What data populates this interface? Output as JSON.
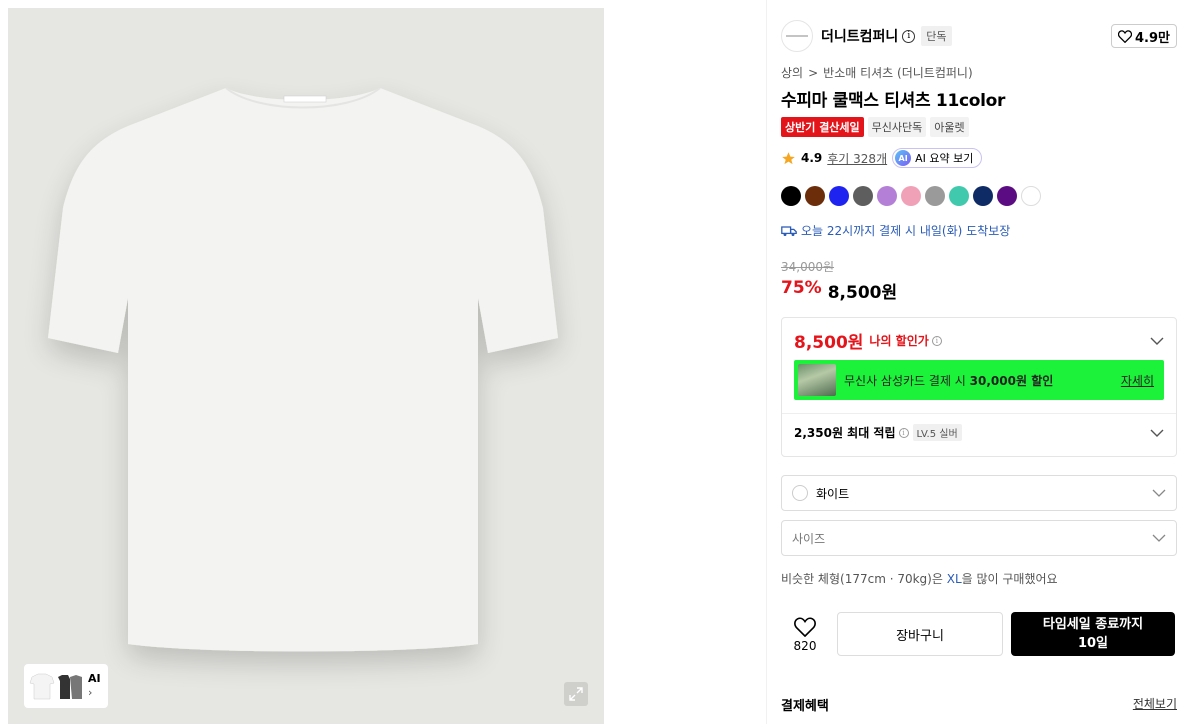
{
  "thumbnail": {
    "ai_label": "AI",
    "chevron": "›"
  },
  "brand": {
    "name": "더니트컴퍼니",
    "info": "i",
    "exclusive": "단독",
    "likes": "4.9만"
  },
  "breadcrumb": {
    "category": "상의",
    "separator": ">",
    "subcategory": "반소매 티셔츠 (더니트컴퍼니)"
  },
  "product": {
    "title": "수피마 쿨맥스 티셔츠 11color",
    "tags": [
      "상반기 결산세일",
      "무신사단독",
      "아울렛"
    ],
    "rating": "4.9",
    "review_count": "후기 328개",
    "ai_badge": "AI",
    "ai_summary": "AI 요약 보기"
  },
  "colors": [
    "#000000",
    "#6b2d0a",
    "#1f23f0",
    "#5e5e5e",
    "#b47fd6",
    "#f0a1b8",
    "#9a9a9a",
    "#40c9ad",
    "#0f2b66",
    "#5b0c82",
    "#ffffff"
  ],
  "delivery": {
    "text": "오늘 22시까지 결제 시 내일(화) 도착보장"
  },
  "price": {
    "original": "34,000원",
    "discount": "75%",
    "final": "8,500원"
  },
  "benefits": {
    "my_price": "8,500원",
    "my_price_label": "나의 할인가",
    "card_text_prefix": "무신사 삼성카드 결제 시 ",
    "card_text_bold": "30,000원 할인",
    "card_detail": "자세히",
    "points": "2,350원 최대 적립",
    "level": "LV.5 실버"
  },
  "options": {
    "color_selected": "화이트",
    "size_placeholder": "사이즈"
  },
  "similar": {
    "prefix": "비슷한 체형(177cm · 70kg)은 ",
    "size": "XL",
    "suffix": "을 많이 구매했어요"
  },
  "actions": {
    "wish_count": "820",
    "cart": "장바구니",
    "buy_line1": "타임세일 종료까지",
    "buy_line2": "10일"
  },
  "payment": {
    "title": "결제혜택",
    "view_all": "전체보기"
  }
}
